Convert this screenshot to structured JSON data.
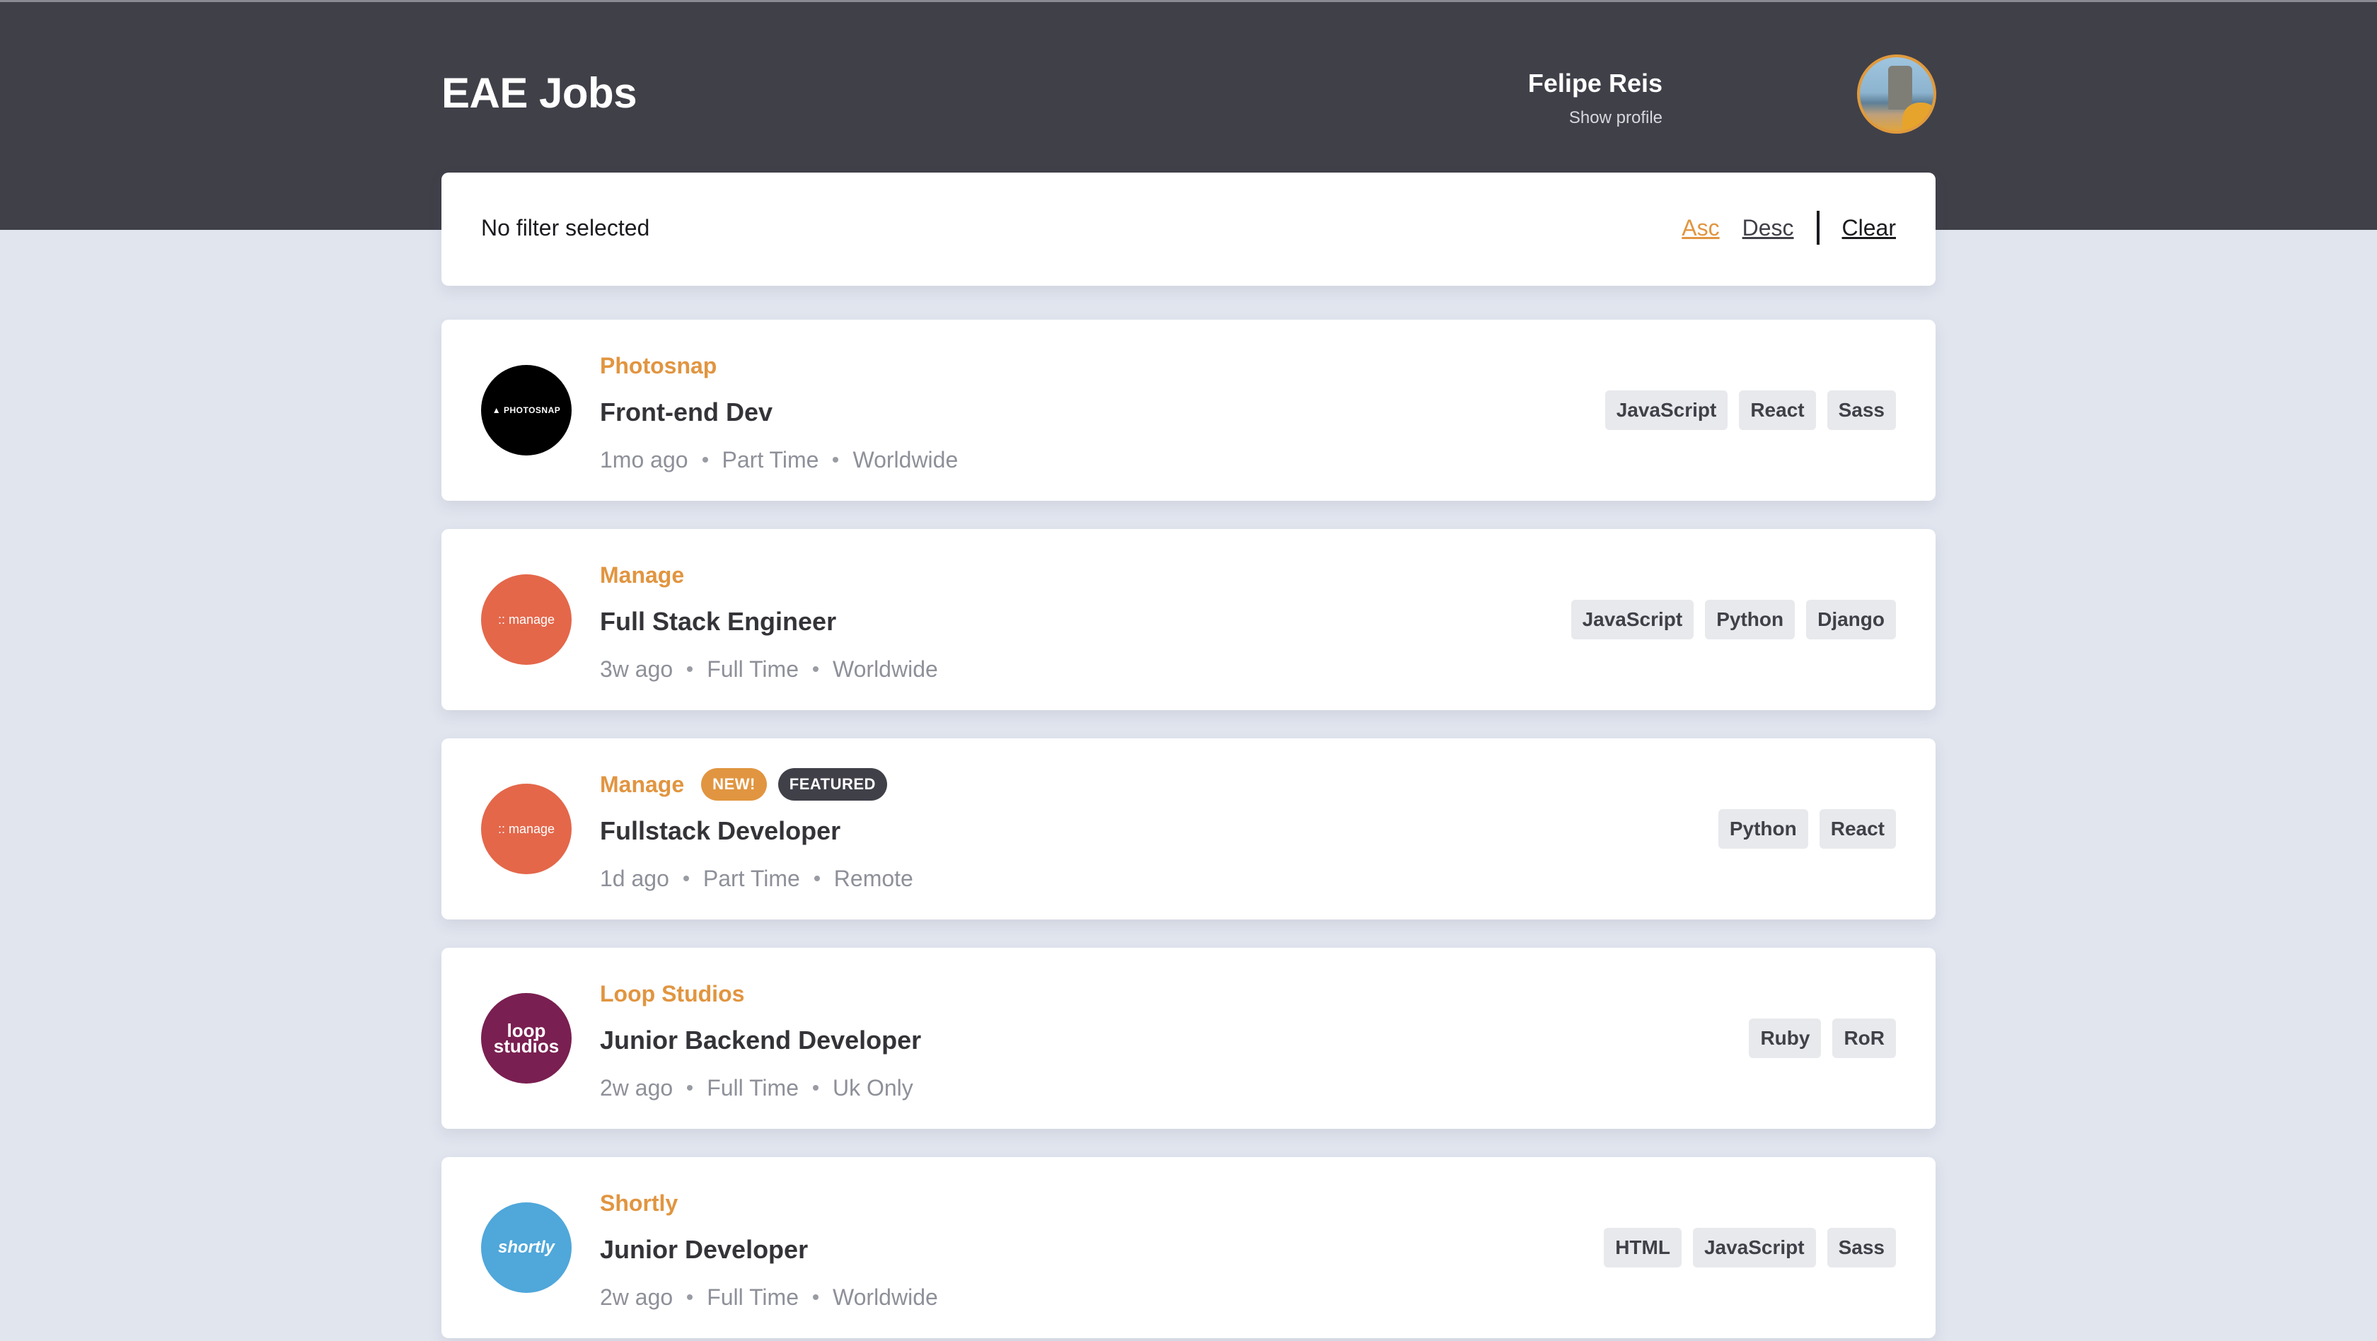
{
  "header": {
    "brand": "EAE Jobs",
    "user_name": "Felipe Reis",
    "profile_link": "Show profile"
  },
  "filter": {
    "status_text": "No filter selected",
    "asc_label": "Asc",
    "desc_label": "Desc",
    "clear_label": "Clear"
  },
  "colors": {
    "accent": "#e19540",
    "header_bg": "#404049",
    "page_bg": "#e1e5ee"
  },
  "jobs": [
    {
      "company": "Photosnap",
      "logo_text": "▲ PHOTOSNAP",
      "position": "Front-end Dev",
      "posted": "1mo ago",
      "contract": "Part Time",
      "location": "Worldwide",
      "tags": [
        "JavaScript",
        "React",
        "Sass"
      ]
    },
    {
      "company": "Manage",
      "logo_text": ":: manage",
      "position": "Full Stack Engineer",
      "posted": "3w ago",
      "contract": "Full Time",
      "location": "Worldwide",
      "tags": [
        "JavaScript",
        "Python",
        "Django"
      ]
    },
    {
      "company": "Manage",
      "logo_text": ":: manage",
      "new_badge": "NEW!",
      "featured_badge": "FEATURED",
      "position": "Fullstack Developer",
      "posted": "1d ago",
      "contract": "Part Time",
      "location": "Remote",
      "tags": [
        "Python",
        "React"
      ]
    },
    {
      "company": "Loop Studios",
      "logo_text_line1": "loop",
      "logo_text_line2": "studios",
      "position": "Junior Backend Developer",
      "posted": "2w ago",
      "contract": "Full Time",
      "location": "Uk Only",
      "tags": [
        "Ruby",
        "RoR"
      ]
    },
    {
      "company": "Shortly",
      "logo_text": "shortly",
      "position": "Junior Developer",
      "posted": "2w ago",
      "contract": "Full Time",
      "location": "Worldwide",
      "tags": [
        "HTML",
        "JavaScript",
        "Sass"
      ]
    }
  ]
}
